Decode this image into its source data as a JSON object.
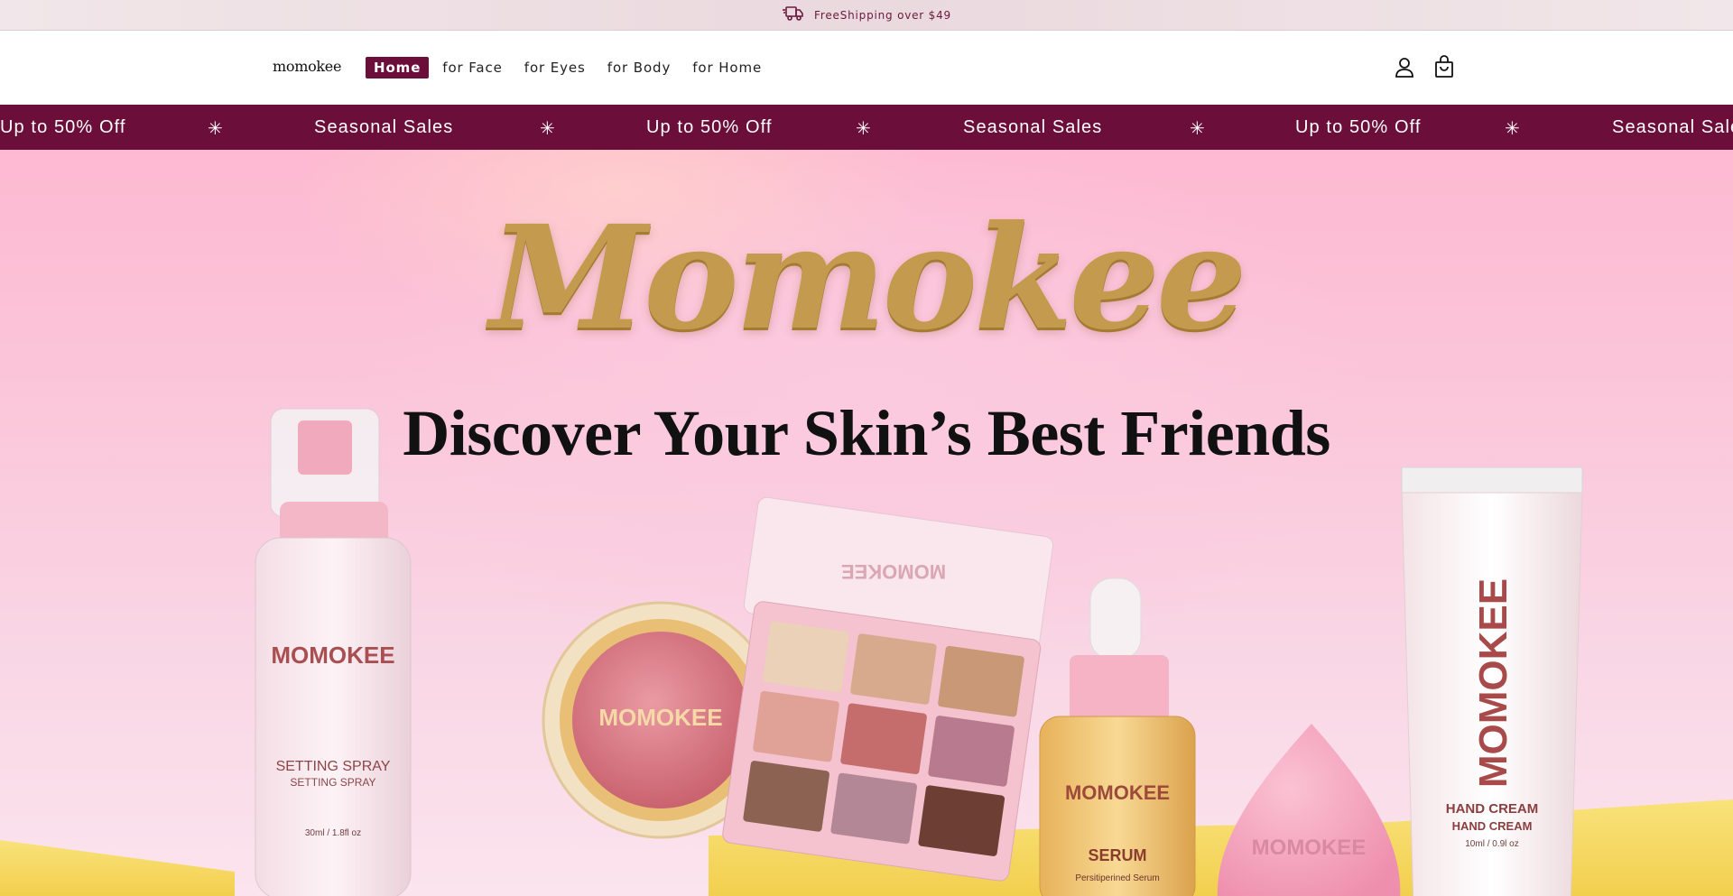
{
  "announcement": {
    "text": "FreeShipping over $49",
    "icon": "truck-icon"
  },
  "header": {
    "logo": "momokee",
    "nav": [
      {
        "label": "Home",
        "active": true
      },
      {
        "label": "for Face",
        "active": false
      },
      {
        "label": "for Eyes",
        "active": false
      },
      {
        "label": "for Body",
        "active": false
      },
      {
        "label": "for Home",
        "active": false
      }
    ],
    "icons": [
      "account-icon",
      "cart-icon"
    ]
  },
  "marquee": {
    "items": [
      "Up to 50% Off",
      "Seasonal Sales",
      "Up to 50% Off",
      "Seasonal Sales",
      "Up to 50% Off",
      "Seasonal Sale"
    ],
    "separator": "✳"
  },
  "hero": {
    "brand": "Momokee",
    "headline": "Discover Your Skin’s Best Friends",
    "products": {
      "spray": {
        "brand": "MOMOKEE",
        "name": "SETTING SPRAY",
        "name2": "SETTING SPRAY",
        "size": "30ml / 1.8fl oz"
      },
      "blush": {
        "brand": "MOMOKEE"
      },
      "palette": {
        "brand": "MOMOKEE"
      },
      "serum": {
        "brand": "MOMOKEE",
        "name": "SERUM",
        "sub": "Persitiperined Serum"
      },
      "sponge": {
        "brand": "MOMOKEE"
      },
      "cream": {
        "brand": "MOMOKEE",
        "name": "HAND CREAM",
        "name2": "HAND CREAM",
        "size": "10ml / 0.9l oz"
      }
    }
  },
  "colors": {
    "brand": "#6b0e3a",
    "gold": "#c49a4f",
    "hero_pink": "#fbc7da"
  }
}
